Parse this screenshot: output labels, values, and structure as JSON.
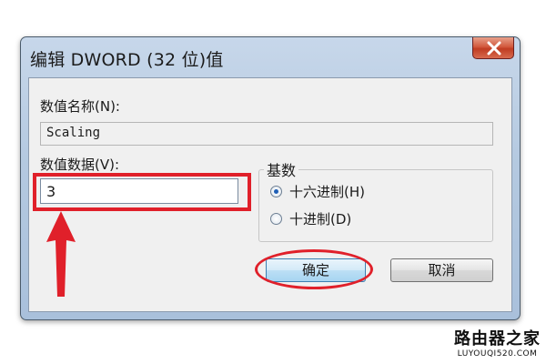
{
  "window": {
    "title": "编辑 DWORD (32 位)值"
  },
  "fields": {
    "name_label": "数值名称(N):",
    "name_value": "Scaling",
    "data_label": "数值数据(V):",
    "data_value": "3"
  },
  "base": {
    "title": "基数",
    "options": [
      {
        "label": "十六进制(H)",
        "checked": true
      },
      {
        "label": "十进制(D)",
        "checked": false
      }
    ]
  },
  "buttons": {
    "ok": "确定",
    "cancel": "取消"
  },
  "watermark": {
    "main": "路由器之家",
    "sub": "LUYOUQI520.COM"
  },
  "colors": {
    "annotation_red": "#e0202a",
    "title_blue": "#b4c9e0"
  }
}
